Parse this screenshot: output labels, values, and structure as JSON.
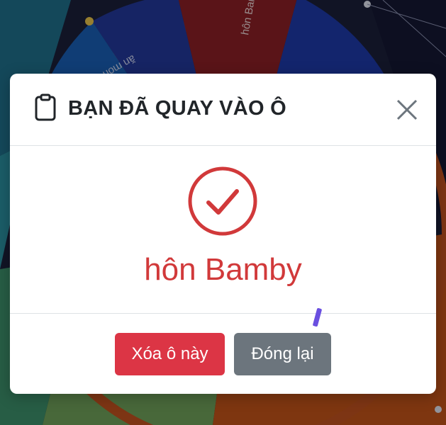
{
  "background": {
    "wheel_labels": [
      "hôn Bamby",
      "ăn mòn cay"
    ]
  },
  "modal": {
    "title": "BẠN ĐÃ QUAY VÀO Ô",
    "title_icon": "clipboard-icon",
    "close_icon": "close-icon",
    "result_icon": "check-circle-icon",
    "result": "hôn Bamby",
    "buttons": {
      "delete_label": "Xóa ô này",
      "close_label": "Đóng lại"
    }
  },
  "colors": {
    "result": "#d1393a",
    "danger": "#dc3545",
    "secondary": "#6c757d"
  }
}
